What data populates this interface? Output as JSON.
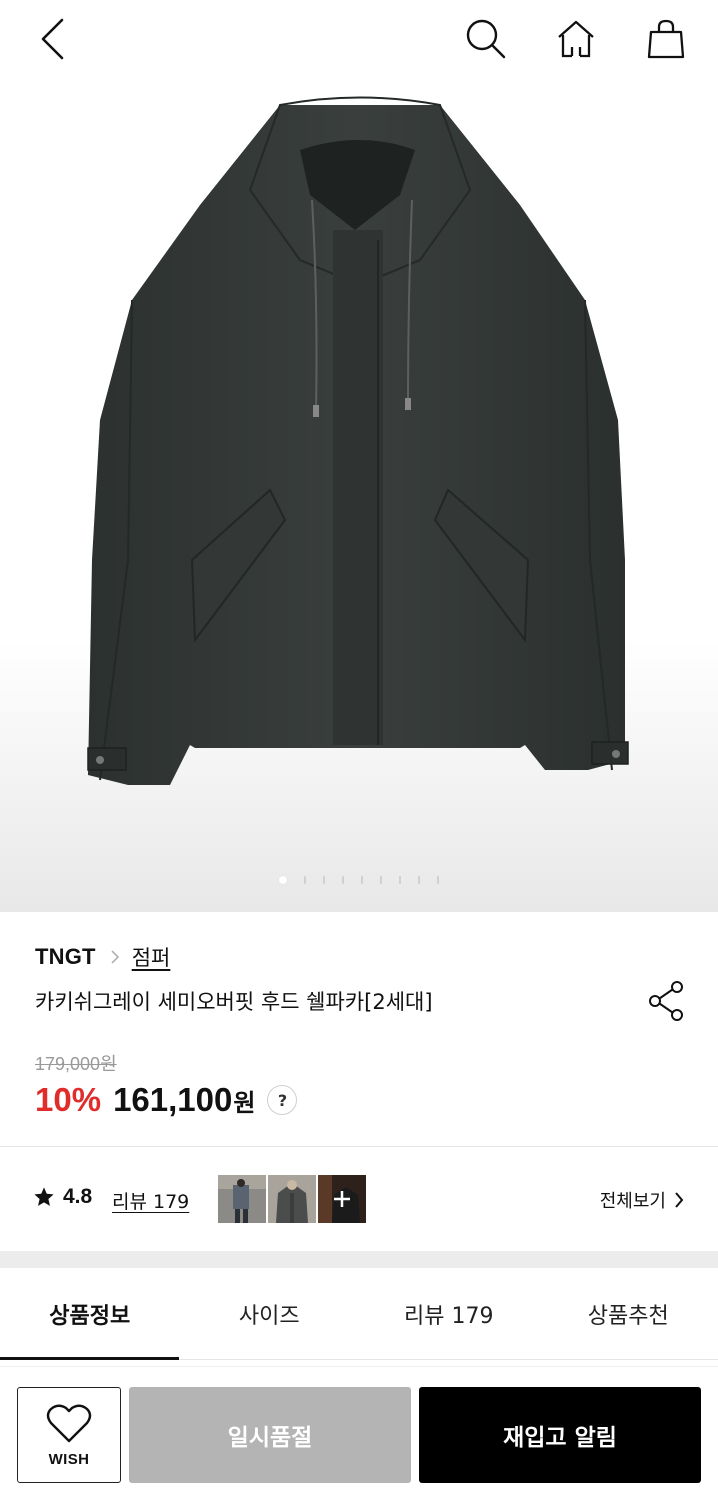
{
  "header": {
    "back_icon": "chevron-left-icon",
    "search_icon": "search-icon",
    "home_icon": "home-icon",
    "bag_icon": "shopping-bag-icon"
  },
  "gallery": {
    "image": "hooded jacket product photo",
    "current_index": 1,
    "total": 9
  },
  "product": {
    "brand": "TNGT",
    "category": "점퍼",
    "title": "카키쉬그레이 세미오버핏 후드 쉘파카[2세대]",
    "original_price": "179,000원",
    "discount": "10%",
    "price": "161,100",
    "currency": "원",
    "help_label": "?"
  },
  "reviews": {
    "rating": "4.8",
    "review_link": "리뷰 179",
    "see_all": "전체보기"
  },
  "tabs": [
    {
      "label": "상품정보"
    },
    {
      "label": "사이즈"
    },
    {
      "label": "리뷰 179"
    },
    {
      "label": "상품추천"
    }
  ],
  "active_tab": 0,
  "actions": {
    "wish_label": "WISH",
    "soldout_label": "일시품절",
    "restock_label": "재입고 알림"
  },
  "colors": {
    "discount_red": "#e12c2c",
    "soldout_gray": "#b4b4b4",
    "primary_black": "#000000"
  }
}
